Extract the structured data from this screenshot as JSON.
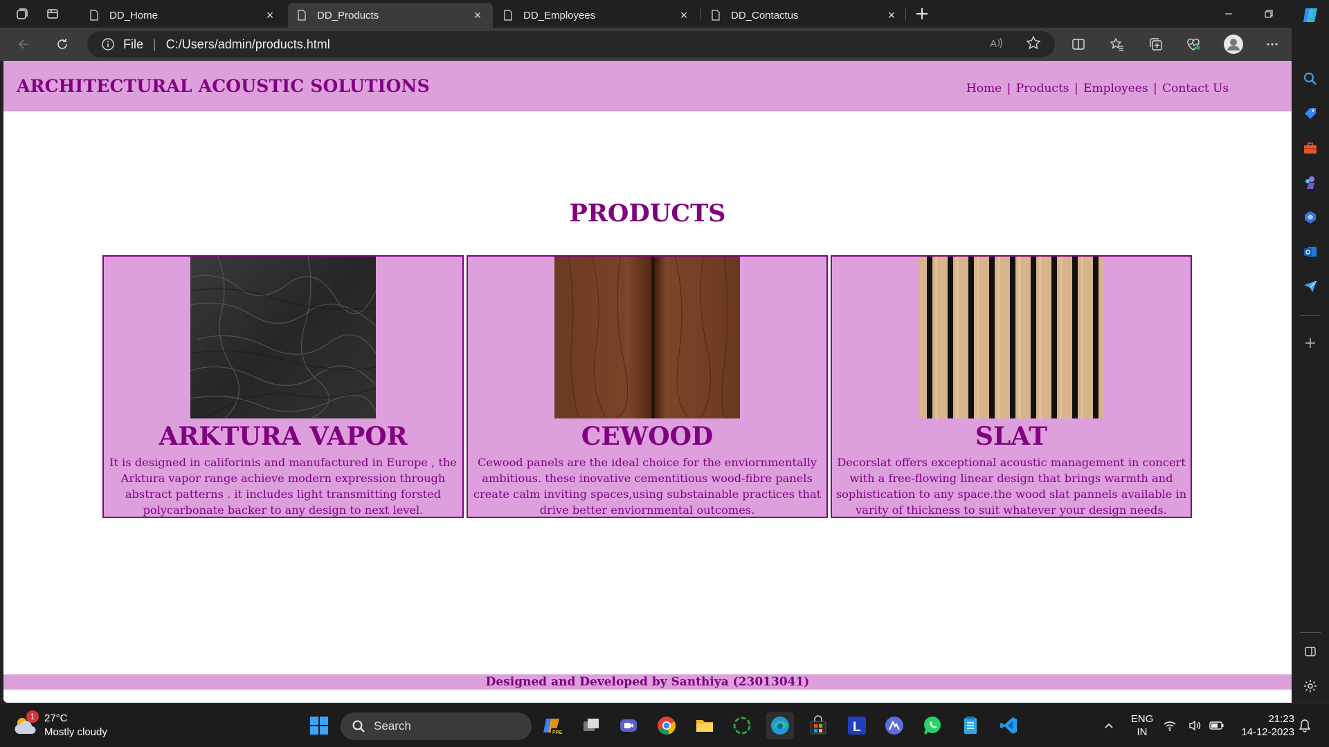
{
  "browser": {
    "tabs": [
      {
        "title": "DD_Home",
        "active": false
      },
      {
        "title": "DD_Products",
        "active": true
      },
      {
        "title": "DD_Employees",
        "active": false
      },
      {
        "title": "DD_Contactus",
        "active": false
      }
    ],
    "address": {
      "scheme_label": "File",
      "url": "C:/Users/admin/products.html"
    }
  },
  "site": {
    "title": "ARCHITECTURAL ACOUSTIC SOLUTIONS",
    "nav": [
      "Home",
      "Products",
      "Employees",
      "Contact Us"
    ],
    "nav_separator": "|",
    "heading": "PRODUCTS",
    "products": [
      {
        "name": "ARKTURA VAPOR",
        "image": "dark-stone-texture",
        "description": "It is designed in califorinis and manufactured in Europe , the Arktura vapor range achieve modern expression through abstract patterns . it includes light transmitting forsted polycarbonate backer to any design to next level."
      },
      {
        "name": "CEWOOD",
        "image": "walnut-wood-panel",
        "description": "Cewood panels are the ideal choice for the enviornmentally ambitious. these inovative cementitious wood-fibre panels create calm inviting spaces,using substainable practices that drive better enviornmental outcomes."
      },
      {
        "name": "SLAT",
        "image": "wood-slat-panel",
        "description": "Decorslat offers exceptional acoustic management in concert with a free-flowing linear design that brings warmth and sophistication to any space.the wood slat pannels available in varity of thickness to suit whatever your design needs."
      }
    ],
    "footer": "Designed and Developed by Santhiya (23013041)",
    "colors": {
      "header_bg": "#dda0dd",
      "text": "#800080"
    }
  },
  "taskbar": {
    "weather": {
      "temp": "27°C",
      "condition": "Mostly cloudy",
      "badge": "1"
    },
    "search_label": "Search",
    "lang": {
      "line1": "ENG",
      "line2": "IN"
    },
    "clock": {
      "time": "21:23",
      "date": "14-12-2023"
    }
  }
}
